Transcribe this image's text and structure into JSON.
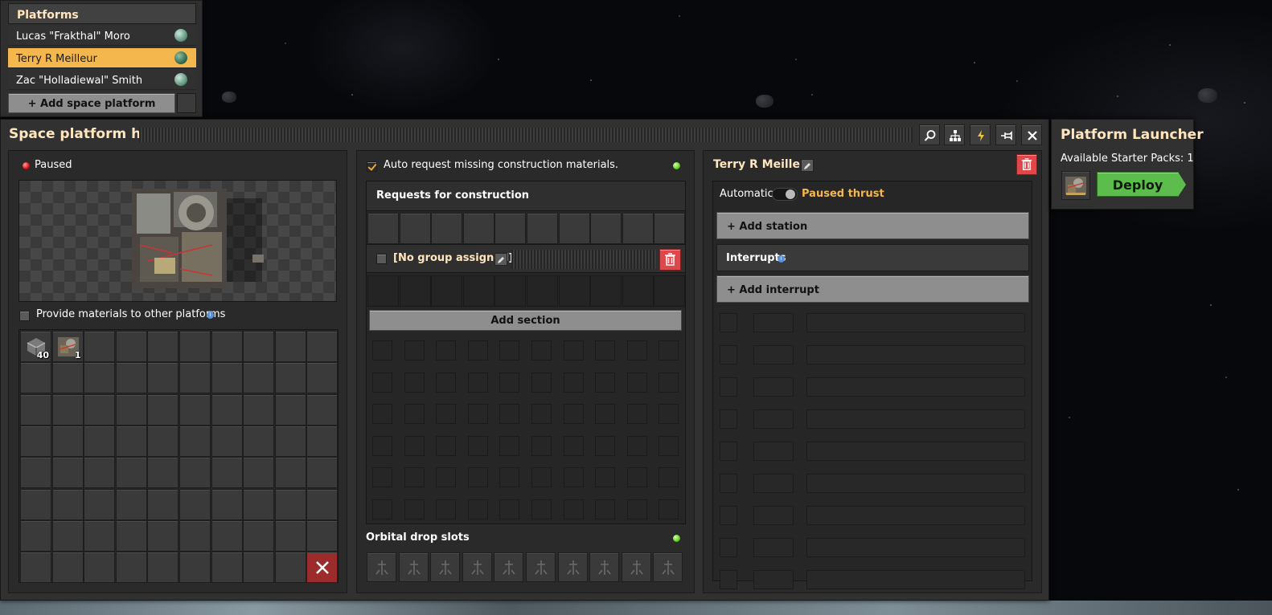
{
  "platforms": {
    "title": "Platforms",
    "items": [
      {
        "name": "Lucas \"Frakthal\" Moro",
        "selected": false
      },
      {
        "name": "Terry R Meilleur",
        "selected": true
      },
      {
        "name": "Zac \"Holladiewal\" Smith",
        "selected": false
      }
    ],
    "add_label": "+ Add space platform"
  },
  "hub": {
    "title": "Space platform hub",
    "toolbar_icons": [
      "search-icon",
      "tech-tree-icon",
      "lightning-icon",
      "pin-icon",
      "close-icon"
    ],
    "status": {
      "text": "Paused",
      "color": "#dd1111"
    },
    "provide_materials_label": "Provide materials to other platforms",
    "inventory": [
      {
        "item": "space-platform-foundation",
        "count": "40"
      },
      {
        "item": "space-platform-starter-pack",
        "count": "1"
      }
    ],
    "auto_request_label": "Auto request missing construction materials.",
    "auto_request_checked": true,
    "requests_title": "Requests for construction",
    "group_label": "[No group assigned]",
    "add_section_label": "Add section",
    "orbital_drop_label": "Orbital drop slots",
    "schedule": {
      "platform_name": "Terry R Meilleur",
      "automatic_label": "Automatic",
      "paused_thrust_label": "Paused thrust",
      "add_station_label": "+ Add station",
      "interrupts_label": "Interrupts",
      "add_interrupt_label": "+ Add interrupt"
    }
  },
  "launcher": {
    "title": "Platform Launcher",
    "available_label": "Available Starter Packs: 1",
    "deploy_label": "Deploy"
  },
  "colors": {
    "accent_title": "#ffe6c0",
    "selected_row": "#f3b74d",
    "paused_thrust": "#f3b74d",
    "deploy_green": "#5cbd4c",
    "delete_red": "#e0474a",
    "status_green": "#5ed21c"
  }
}
